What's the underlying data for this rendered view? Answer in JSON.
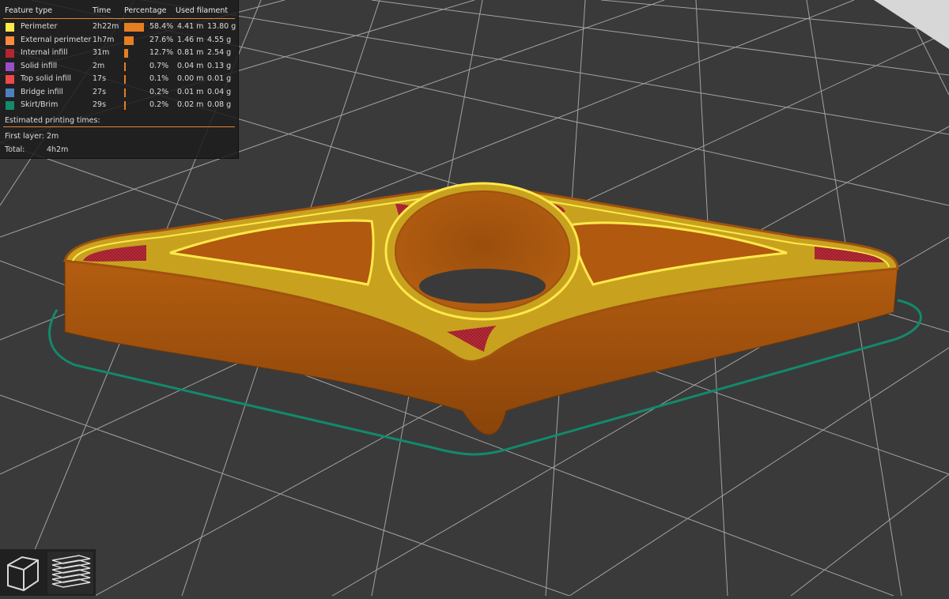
{
  "legend": {
    "headers": {
      "feature_type": "Feature type",
      "time": "Time",
      "percentage": "Percentage",
      "used_filament": "Used filament"
    },
    "rows": [
      {
        "name": "Perimeter",
        "color": "#ffe84a",
        "time": "2h22m",
        "pct_value": 58.4,
        "pct": "58.4%",
        "length": "4.41 m",
        "weight": "13.80 g"
      },
      {
        "name": "External perimeter",
        "color": "#ff8a3d",
        "time": "1h7m",
        "pct_value": 27.6,
        "pct": "27.6%",
        "length": "1.46 m",
        "weight": "4.55 g"
      },
      {
        "name": "Internal infill",
        "color": "#b3262e",
        "time": "31m",
        "pct_value": 12.7,
        "pct": "12.7%",
        "length": "0.81 m",
        "weight": "2.54 g"
      },
      {
        "name": "Solid infill",
        "color": "#9a4fc8",
        "time": "2m",
        "pct_value": 0.7,
        "pct": "0.7%",
        "length": "0.04 m",
        "weight": "0.13 g"
      },
      {
        "name": "Top solid infill",
        "color": "#f04848",
        "time": "17s",
        "pct_value": 0.1,
        "pct": "0.1%",
        "length": "0.00 m",
        "weight": "0.01 g"
      },
      {
        "name": "Bridge infill",
        "color": "#4f7fbf",
        "time": "27s",
        "pct_value": 0.2,
        "pct": "0.2%",
        "length": "0.01 m",
        "weight": "0.04 g"
      },
      {
        "name": "Skirt/Brim",
        "color": "#128a6c",
        "time": "29s",
        "pct_value": 0.2,
        "pct": "0.2%",
        "length": "0.02 m",
        "weight": "0.08 g"
      }
    ],
    "estimated_label": "Estimated printing times:",
    "first_layer_label": "First layer:",
    "first_layer_value": "2m",
    "total_label": "Total:",
    "total_value": "4h2m"
  },
  "view_buttons": [
    {
      "name": "3d-view-icon"
    },
    {
      "name": "layers-view-icon"
    }
  ],
  "colors": {
    "background": "#3a3a3a",
    "grid": "#b8b8b8",
    "model_side": "#a0520e",
    "model_top_layer": "#c8a21e",
    "accent": "#e0862e",
    "skirt": "#128a6c"
  }
}
